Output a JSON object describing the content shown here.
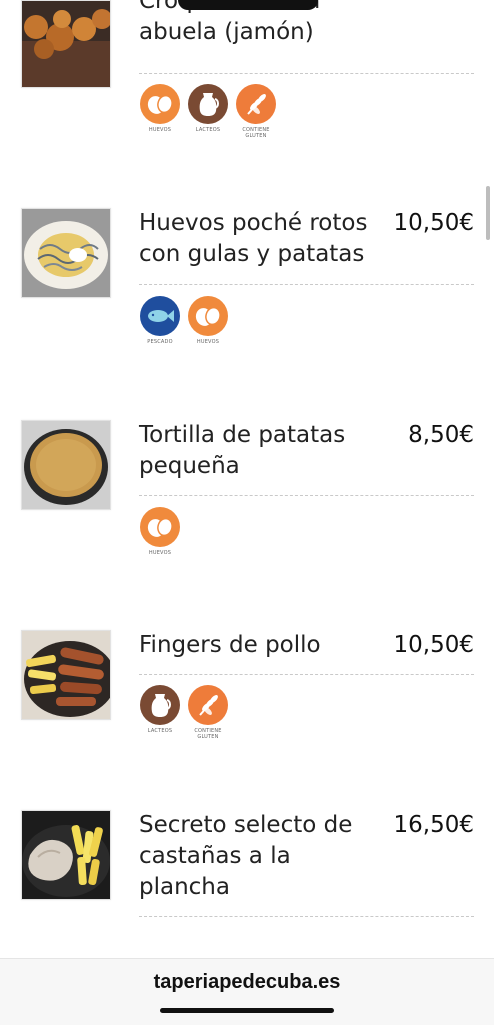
{
  "items": [
    {
      "title": "Croquetas de la abuela (jamón)",
      "title_line_top": "Croquetas de la",
      "title_line_bottom": "abuela (jamón)",
      "price": "",
      "allergens": [
        {
          "icon": "eggs-icon",
          "label": "HUEVOS",
          "color": "#F08A3C"
        },
        {
          "icon": "milk-jug-icon",
          "label": "LACTEOS",
          "color": "#7A4A33"
        },
        {
          "icon": "wheat-icon",
          "label": "CONTIENE GLUTEN",
          "color": "#EE7C3A"
        }
      ]
    },
    {
      "title": "Huevos poché rotos con gulas y patatas",
      "price": "10,50€",
      "allergens": [
        {
          "icon": "fish-icon",
          "label": "PESCADO",
          "color": "#1F4E9E"
        },
        {
          "icon": "eggs-icon",
          "label": "HUEVOS",
          "color": "#F08A3C"
        }
      ]
    },
    {
      "title": "Tortilla de patatas pequeña",
      "price": "8,50€",
      "allergens": [
        {
          "icon": "eggs-icon",
          "label": "HUEVOS",
          "color": "#F08A3C"
        }
      ]
    },
    {
      "title": "Fingers de pollo",
      "price": "10,50€",
      "allergens": [
        {
          "icon": "milk-jug-icon",
          "label": "LACTEOS",
          "color": "#7A4A33"
        },
        {
          "icon": "wheat-icon",
          "label": "CONTIENE GLUTEN",
          "color": "#EE7C3A"
        }
      ]
    },
    {
      "title": "Secreto selecto de castañas a la plancha",
      "price": "16,50€",
      "allergens": []
    }
  ],
  "footer": {
    "url": "taperiapedecuba.es"
  }
}
